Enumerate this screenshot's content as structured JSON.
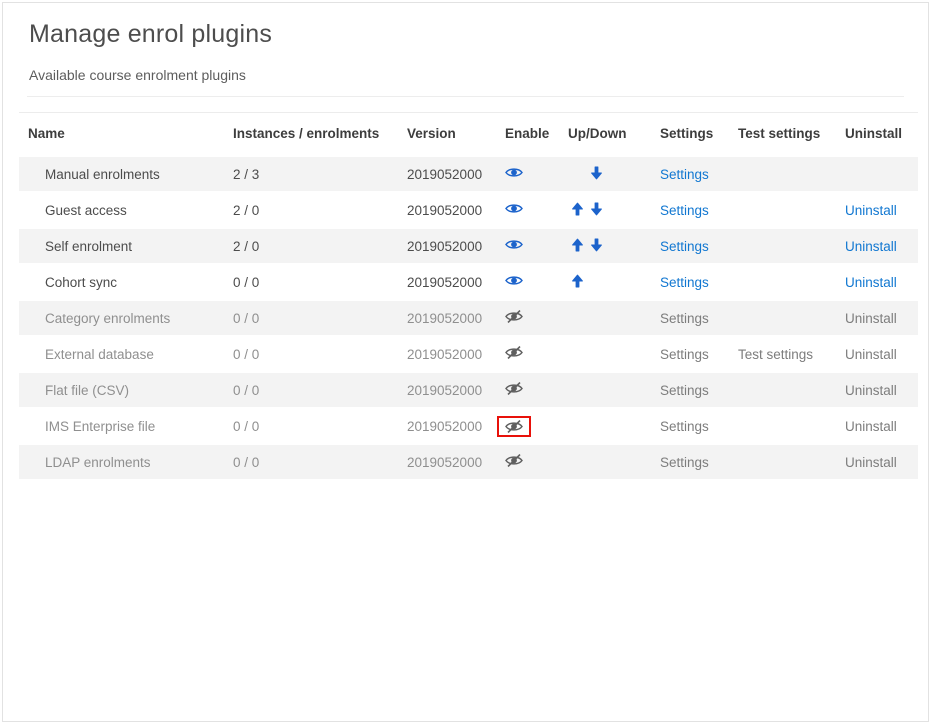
{
  "page": {
    "title": "Manage enrol plugins",
    "subtitle": "Available course enrolment plugins"
  },
  "colors": {
    "link_blue": "#1177d1",
    "icon_blue": "#1c63cb",
    "icon_gray": "#5f5f5f",
    "muted_text": "#8f8f8f",
    "row_stripe": "#f3f3f3",
    "highlight_red": "#e8110a"
  },
  "icons": {
    "enabled": "eye-icon",
    "disabled": "eye-slash-icon",
    "up": "arrow-up-icon",
    "down": "arrow-down-icon"
  },
  "table": {
    "headers": [
      {
        "id": "name",
        "label": "Name"
      },
      {
        "id": "instances",
        "label": "Instances / enrolments"
      },
      {
        "id": "version",
        "label": "Version"
      },
      {
        "id": "enable",
        "label": "Enable"
      },
      {
        "id": "updown",
        "label": "Up/Down"
      },
      {
        "id": "settings",
        "label": "Settings"
      },
      {
        "id": "testsettings",
        "label": "Test settings"
      },
      {
        "id": "uninstall",
        "label": "Uninstall"
      }
    ],
    "rows": [
      {
        "name": "Manual enrolments",
        "instances": "2 / 3",
        "version": "2019052000",
        "enabled": true,
        "up": false,
        "down": true,
        "settings": "Settings",
        "test_settings": "",
        "uninstall": "",
        "highlighted": false
      },
      {
        "name": "Guest access",
        "instances": "2 / 0",
        "version": "2019052000",
        "enabled": true,
        "up": true,
        "down": true,
        "settings": "Settings",
        "test_settings": "",
        "uninstall": "Uninstall",
        "highlighted": false
      },
      {
        "name": "Self enrolment",
        "instances": "2 / 0",
        "version": "2019052000",
        "enabled": true,
        "up": true,
        "down": true,
        "settings": "Settings",
        "test_settings": "",
        "uninstall": "Uninstall",
        "highlighted": false
      },
      {
        "name": "Cohort sync",
        "instances": "0 / 0",
        "version": "2019052000",
        "enabled": true,
        "up": true,
        "down": false,
        "settings": "Settings",
        "test_settings": "",
        "uninstall": "Uninstall",
        "highlighted": false
      },
      {
        "name": "Category enrolments",
        "instances": "0 / 0",
        "version": "2019052000",
        "enabled": false,
        "up": false,
        "down": false,
        "settings": "Settings",
        "test_settings": "",
        "uninstall": "Uninstall",
        "highlighted": false
      },
      {
        "name": "External database",
        "instances": "0 / 0",
        "version": "2019052000",
        "enabled": false,
        "up": false,
        "down": false,
        "settings": "Settings",
        "test_settings": "Test settings",
        "uninstall": "Uninstall",
        "highlighted": false
      },
      {
        "name": "Flat file (CSV)",
        "instances": "0 / 0",
        "version": "2019052000",
        "enabled": false,
        "up": false,
        "down": false,
        "settings": "Settings",
        "test_settings": "",
        "uninstall": "Uninstall",
        "highlighted": false
      },
      {
        "name": "IMS Enterprise file",
        "instances": "0 / 0",
        "version": "2019052000",
        "enabled": false,
        "up": false,
        "down": false,
        "settings": "Settings",
        "test_settings": "",
        "uninstall": "Uninstall",
        "highlighted": true
      },
      {
        "name": "LDAP enrolments",
        "instances": "0 / 0",
        "version": "2019052000",
        "enabled": false,
        "up": false,
        "down": false,
        "settings": "Settings",
        "test_settings": "",
        "uninstall": "Uninstall",
        "highlighted": false
      }
    ]
  }
}
